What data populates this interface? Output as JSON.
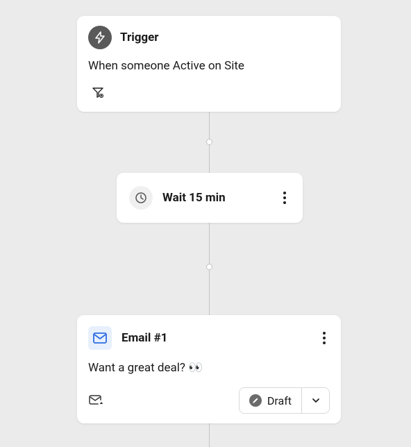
{
  "trigger": {
    "title": "Trigger",
    "description": "When someone Active on Site"
  },
  "wait": {
    "label": "Wait 15 min"
  },
  "email": {
    "title": "Email #1",
    "subject": "Want a great deal? 👀",
    "status_label": "Draft"
  }
}
